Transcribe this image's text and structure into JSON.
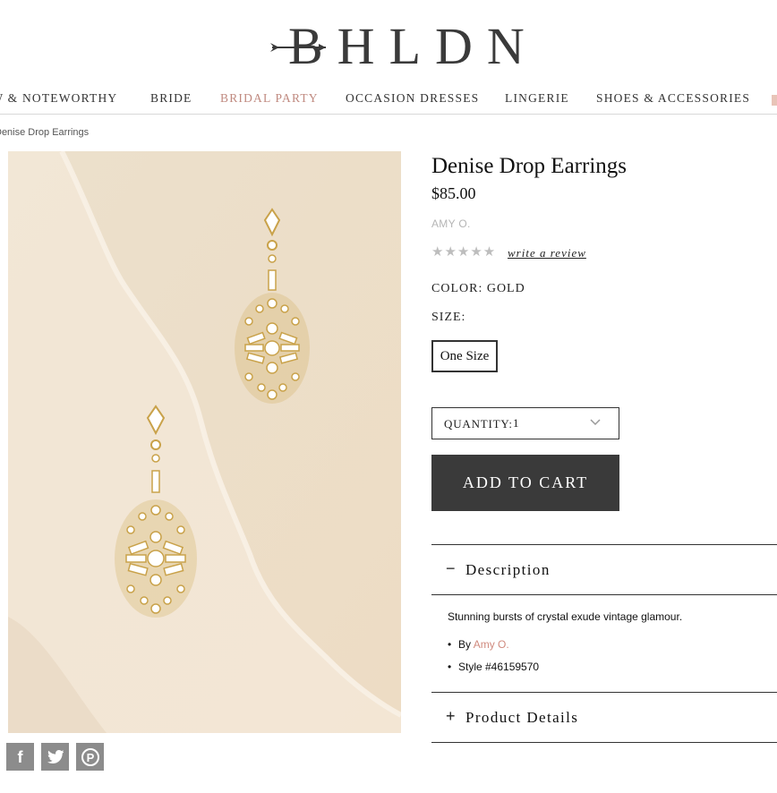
{
  "header": {
    "logo_text": "BHLDN"
  },
  "nav": {
    "items": [
      {
        "label": "NEW & NOTEWORTHY",
        "active": false
      },
      {
        "label": "BRIDE",
        "active": false
      },
      {
        "label": "BRIDAL PARTY",
        "active": true
      },
      {
        "label": "OCCASION DRESSES",
        "active": false
      },
      {
        "label": "LINGERIE",
        "active": false
      },
      {
        "label": "SHOES & ACCESSORIES",
        "active": false
      }
    ]
  },
  "breadcrumb": {
    "current": "Denise Drop Earrings"
  },
  "product": {
    "title": "Denise Drop Earrings",
    "price": "$85.00",
    "brand": "AMY O.",
    "rating_stars": "★★★★★",
    "write_review": "write a review",
    "color_label": "COLOR: GOLD",
    "size_label": "SIZE:",
    "size_option": "One Size",
    "quantity_label": "QUANTITY:",
    "quantity_value": "1",
    "add_to_cart": "ADD TO CART"
  },
  "description": {
    "sign": "−",
    "title": "Description",
    "text": "Stunning bursts of crystal exude vintage glamour.",
    "by_prefix": "By ",
    "by_link": "Amy O.",
    "style": "Style #46159570"
  },
  "product_details": {
    "sign": "+",
    "title": "Product Details"
  },
  "social": {
    "facebook": "f",
    "twitter_icon": "twitter-icon",
    "pinterest": "P"
  },
  "colors": {
    "accent": "#c08a80",
    "button_bg": "#3a3a3a",
    "image_bg": "#efe3d0"
  }
}
